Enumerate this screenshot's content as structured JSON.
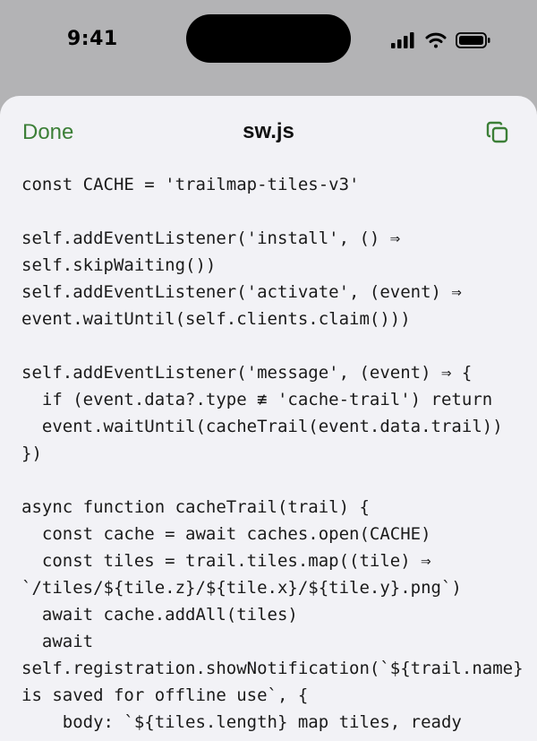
{
  "status": {
    "time": "9:41",
    "icons": [
      "cellular-signal-icon",
      "wifi-icon",
      "battery-icon"
    ]
  },
  "sheet": {
    "done_label": "Done",
    "title": "sw.js",
    "copy_icon": "copy-icon",
    "accent_color": "#3c7f37"
  },
  "code_lines": [
    "const CACHE = 'trailmap-tiles-v3'",
    "",
    "self.addEventListener('install', () ⇒",
    "self.skipWaiting())",
    "self.addEventListener('activate', (event) ⇒",
    "event.waitUntil(self.clients.claim()))",
    "",
    "self.addEventListener('message', (event) ⇒ {",
    "  if (event.data?.type ≢ 'cache-trail') return",
    "  event.waitUntil(cacheTrail(event.data.trail))",
    "})",
    "",
    "async function cacheTrail(trail) {",
    "  const cache = await caches.open(CACHE)",
    "  const tiles = trail.tiles.map((tile) ⇒",
    "`/tiles/${tile.z}/${tile.x}/${tile.y}.png`)",
    "  await cache.addAll(tiles)",
    "  await",
    "self.registration.showNotification(`${trail.name}",
    "is saved for offline use`, {",
    "    body: `${tiles.length} map tiles, ready"
  ]
}
